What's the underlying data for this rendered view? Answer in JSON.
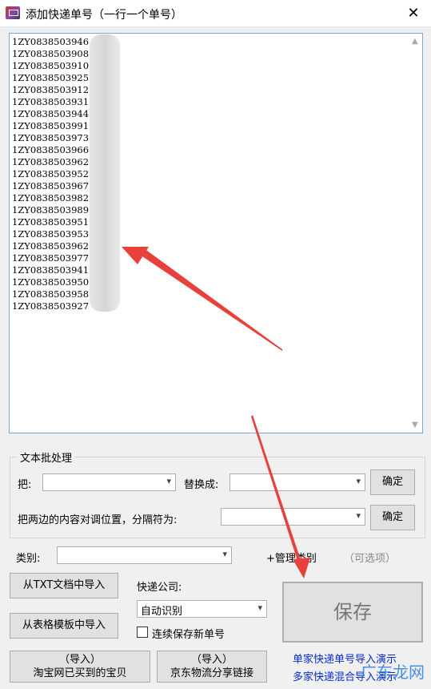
{
  "window": {
    "title": "添加快递单号（一行一个单号）",
    "close": "✕"
  },
  "tracking_numbers": [
    "1ZY0838503946  43",
    "1ZY0838503908  1",
    "1ZY0838503910  4",
    "1ZY0838503925  7",
    "1ZY0838503912  5",
    "1ZY0838503931  7",
    "1ZY0838503944  2",
    "1ZY0838503991  1",
    "1ZY0838503973  3",
    "1ZY0838503966  0",
    "1ZY0838503962  ",
    "1ZY0838503952  ",
    "1ZY0838503967  ",
    "1ZY0838503982  ",
    "1ZY0838503989  ",
    "1ZY0838503951  ",
    "1ZY0838503953  ",
    "1ZY0838503962  ",
    "1ZY0838503977  ",
    "1ZY0838503941  ",
    "1ZY0838503950  ",
    "1ZY0838503958  ",
    "1ZY0838503927  9"
  ],
  "batch": {
    "group_title": "文本批处理",
    "replace_label": "把:",
    "replace_with_label": "替换成:",
    "ok1": "确定",
    "swap_label": "把两边的内容对调位置，分隔符为:",
    "ok2": "确定"
  },
  "category": {
    "label": "类别:",
    "manage": "+管理类别",
    "optional": "（可选项）"
  },
  "courier": {
    "label": "快递公司:",
    "value": "自动识别"
  },
  "buttons": {
    "import_txt": "从TXT文档中导入",
    "import_table": "从表格模板中导入",
    "import_taobao_1": "（导入）",
    "import_taobao_2": "淘宝网已买到的宝贝",
    "import_jd_1": "（导入）",
    "import_jd_2": "京东物流分享链接",
    "save": "保存"
  },
  "checkbox_label": "连续保存新单号",
  "links": {
    "single": "单家快递单号导入演示",
    "multi": "多家快递混合导入演示"
  },
  "watermark": "广东龙网",
  "colors": {
    "arrow": "#e8403a",
    "link": "#0a2ad0",
    "border_focus": "#7aa7d6"
  }
}
